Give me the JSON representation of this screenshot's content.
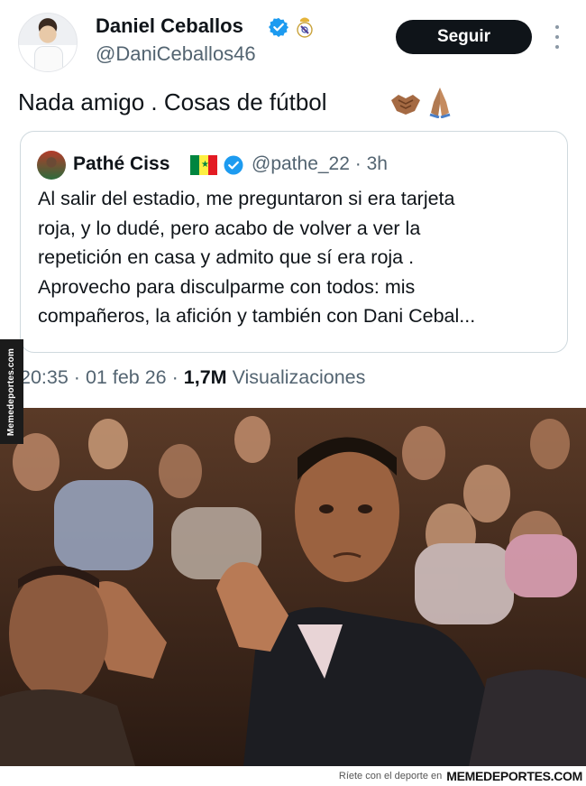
{
  "tweet": {
    "author_name": "Daniel Ceballos",
    "author_handle": "@DaniCeballos46",
    "follow_label": "Seguir",
    "text": "Nada amigo . Cosas de fútbol",
    "emojis": [
      "handshake-icon",
      "folded-hands-icon"
    ],
    "quote": {
      "author_name": "Pathé Ciss",
      "author_handle": "@pathe_22",
      "separator": "·",
      "time_ago": "3h",
      "lines": [
        "Al salir del estadio, me preguntaron si era tarjeta",
        "roja, y lo dudé, pero acabo de volver a ver la",
        "repetición en casa y admito que sí era roja .",
        "Aprovecho para disculparme con todos: mis",
        "compañeros, la afición y también con Dani Cebal..."
      ]
    },
    "time": "20:35",
    "date": "01 feb 26",
    "separator": "·",
    "views_count": "1,7M",
    "views_label": "Visualizaciones"
  },
  "watermark": {
    "vertical": "Memedeportes.com",
    "tagline": "Ríete con el deporte en",
    "brand": "MEMEDEPORTES.COM"
  },
  "colors": {
    "text_primary": "#0f1419",
    "text_secondary": "#536471",
    "verified_blue": "#1d9bf0",
    "button_bg": "#0f1419",
    "border": "#cfd9de",
    "flag": [
      "#00853f",
      "#fdef42",
      "#e31b23"
    ]
  }
}
